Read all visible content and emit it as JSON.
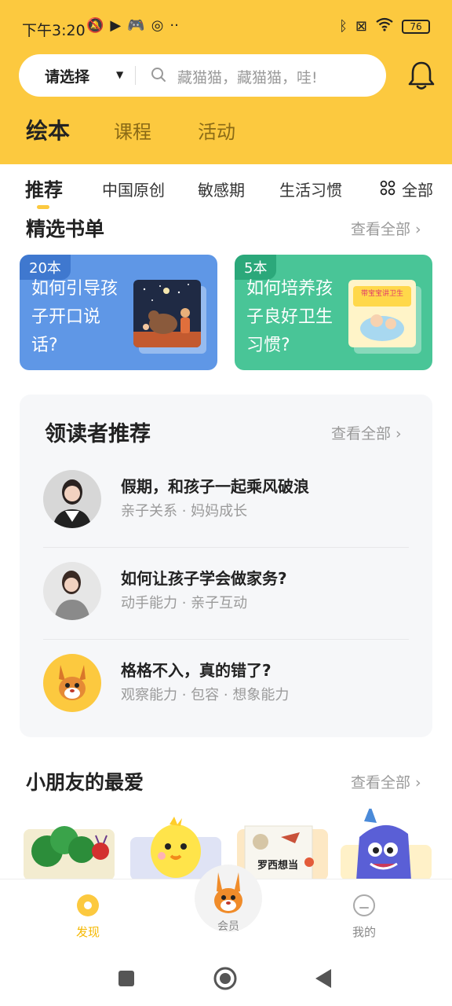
{
  "status_bar": {
    "time": "下午3:20",
    "battery": "76"
  },
  "search": {
    "selector_label": "请选择",
    "placeholder": "藏猫猫，藏猫猫，哇!"
  },
  "main_tabs": [
    {
      "label": "绘本"
    },
    {
      "label": "课程"
    },
    {
      "label": "活动"
    }
  ],
  "sub_tabs": [
    {
      "label": "推荐"
    },
    {
      "label": "中国原创"
    },
    {
      "label": "敏感期"
    },
    {
      "label": "生活习惯"
    },
    {
      "label": "全部"
    }
  ],
  "booklists": {
    "title": "精选书单",
    "see_all": "查看全部 ›",
    "items": [
      {
        "count": "20本",
        "title": "如何引导孩子开口说话?",
        "bg": "#5f97e6",
        "badge": "#3f78cf"
      },
      {
        "count": "5本",
        "title": "如何培养孩子良好卫生习惯?",
        "bg": "#49c597",
        "badge": "#2ba87a",
        "cover_text": "带宝宝讲卫生"
      }
    ]
  },
  "leaders": {
    "title": "领读者推荐",
    "see_all": "查看全部 ›",
    "items": [
      {
        "title": "假期，和孩子一起乘风破浪",
        "tags": "亲子关系 · 妈妈成长"
      },
      {
        "title": "如何让孩子学会做家务?",
        "tags": "动手能力 · 亲子互动"
      },
      {
        "title": "格格不入，真的错了?",
        "tags": "观察能力 · 包容 · 想象能力"
      }
    ]
  },
  "favorites": {
    "title": "小朋友的最爱",
    "see_all": "查看全部 ›",
    "cover_text": "罗西想当"
  },
  "bottom_nav": {
    "discover": "发现",
    "member": "会员",
    "mine": "我的"
  },
  "colors": {
    "accent": "#fcc93f",
    "active_nav": "#f5b800"
  }
}
